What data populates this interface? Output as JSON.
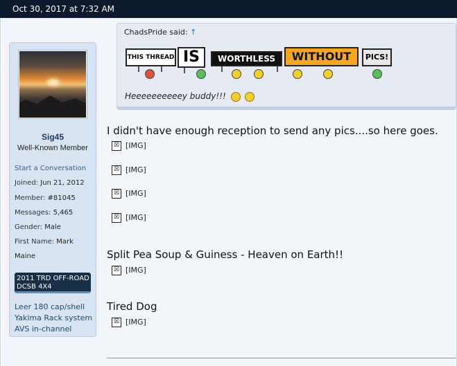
{
  "header": {
    "timestamp": "Oct 30, 2017 at 7:32 AM"
  },
  "user": {
    "name": "Sig45",
    "title": "Well-Known Member",
    "start_conversation": "Start a Conversation",
    "fields": [
      {
        "k": "Joined:",
        "v": "Jun 21, 2012"
      },
      {
        "k": "Member:",
        "v": "#81045"
      },
      {
        "k": "Messages:",
        "v": "5,465"
      },
      {
        "k": "Gender:",
        "v": "Male"
      },
      {
        "k": "First Name:",
        "v": "Mark"
      }
    ],
    "location": "Maine",
    "truck": "2011 TRD OFF-ROAD DCSB 4X4",
    "extras": [
      "Leer 180 cap/shell",
      "Yakima Rack system",
      "AVS in-channel"
    ]
  },
  "quote": {
    "author": "ChadsPride said:",
    "arrow": "↑",
    "signs": [
      "THIS THREAD",
      "IS",
      "WORTHLESS",
      "WITHOUT",
      "PICS!"
    ],
    "text": "Heeeeeeeeeey buddy!!!"
  },
  "post": {
    "line1": "I didn't have enough reception to send any pics....so here goes.",
    "line2": "Split Pea Soup & Guiness - Heaven on Earth!!",
    "line3": "Tired Dog",
    "img_label": "[IMG]",
    "img_icon": "☒"
  },
  "colors": {
    "topbar": "#0d1a2e",
    "panel": "#d9e4f3",
    "username": "#1d3a66"
  }
}
